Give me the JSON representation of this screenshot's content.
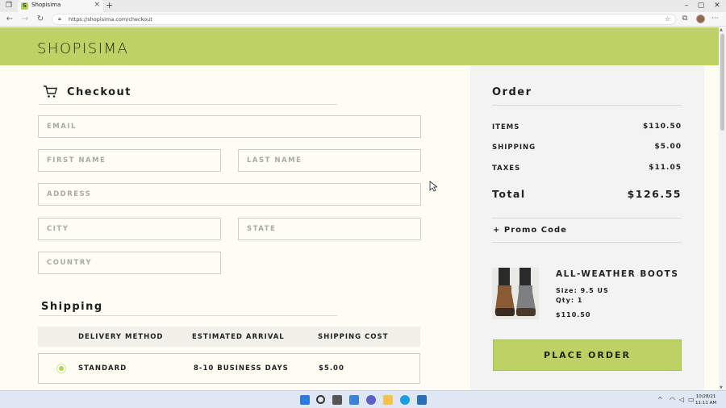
{
  "browser": {
    "tab_title": "Shopisima",
    "tab_favicon": "S",
    "url": "https://shopisima.com/checkout"
  },
  "brand": {
    "logo": "SHOPISIMA",
    "accent": "#bdd264"
  },
  "checkout": {
    "title": "Checkout",
    "fields": {
      "email": "EMAIL",
      "first_name": "FIRST NAME",
      "last_name": "LAST NAME",
      "address": "ADDRESS",
      "city": "CITY",
      "state": "STATE",
      "country": "COUNTRY"
    }
  },
  "shipping": {
    "title": "Shipping",
    "columns": [
      "DELIVERY METHOD",
      "ESTIMATED ARRIVAL",
      "SHIPPING COST"
    ],
    "options": [
      {
        "method": "STANDARD",
        "arrival": "8-10 BUSINESS DAYS",
        "cost": "$5.00",
        "selected": true
      }
    ]
  },
  "order": {
    "title": "Order",
    "items_label": "ITEMS",
    "items_value": "$110.50",
    "shipping_label": "SHIPPING",
    "shipping_value": "$5.00",
    "taxes_label": "TAXES",
    "taxes_value": "$11.05",
    "total_label": "Total",
    "total_value": "$126.55",
    "promo_label": "+ Promo Code",
    "product": {
      "name": "ALL-WEATHER BOOTS",
      "size": "Size: 9.5 US",
      "qty": "Qty: 1",
      "price": "$110.50"
    },
    "place_order": "PLACE ORDER"
  },
  "taskbar": {
    "time": "11:11 AM",
    "date": "10/28/21"
  }
}
